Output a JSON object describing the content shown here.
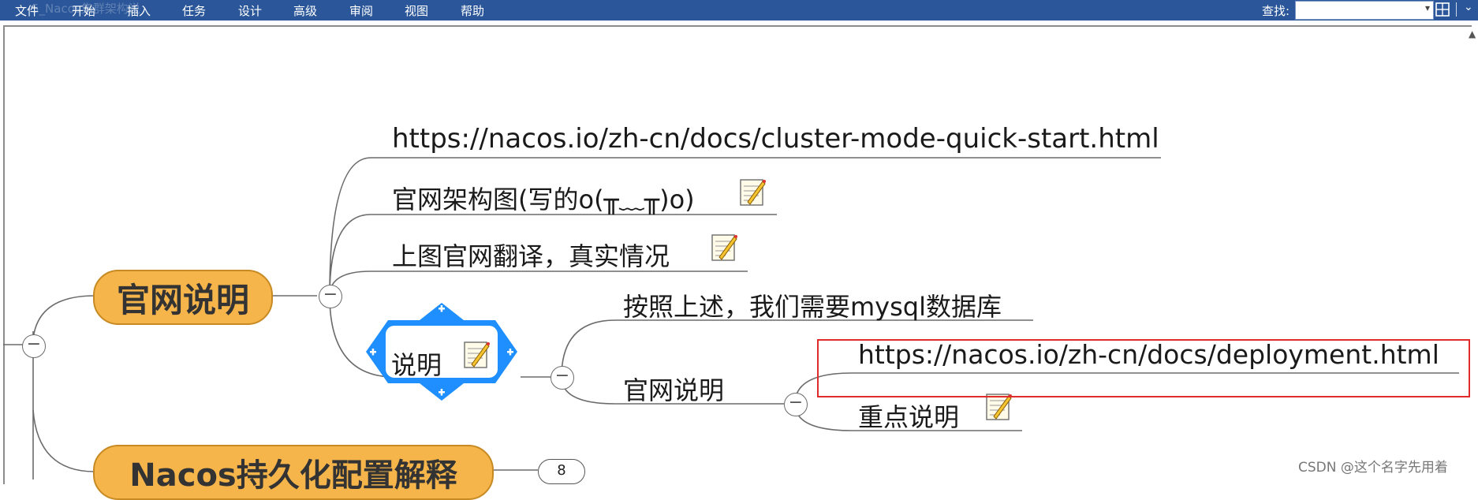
{
  "menubar": {
    "items": [
      "文件",
      "开始",
      "插入",
      "任务",
      "设计",
      "高级",
      "审阅",
      "视图",
      "帮助"
    ],
    "search_label": "查找:",
    "search_value": "",
    "ghost_title": "5_Nacos集群架构说"
  },
  "mindmap": {
    "main_topic_1": "官网说明",
    "main_topic_2": "Nacos持久化配置解释",
    "main_topic_2_count": "8",
    "children": {
      "link_cluster": "https://nacos.io/zh-cn/docs/cluster-mode-quick-start.html",
      "arch_diagram": "官网架构图(写的o(╥﹏╥)o)",
      "translation": "上图官网翻译，真实情况",
      "note_node": "说明"
    },
    "note_children": {
      "mysql_need": "按照上述，我们需要mysql数据库",
      "official_desc": "官网说明"
    },
    "official_children": {
      "link_deployment": "https://nacos.io/zh-cn/docs/deployment.html",
      "key_note": "重点说明"
    }
  },
  "watermark": "CSDN @这个名字先用着",
  "colors": {
    "menubar": "#2b579a",
    "main_topic": "#f6b54a",
    "selection": "#1f8fff",
    "highlight_box": "#e02b2b"
  }
}
